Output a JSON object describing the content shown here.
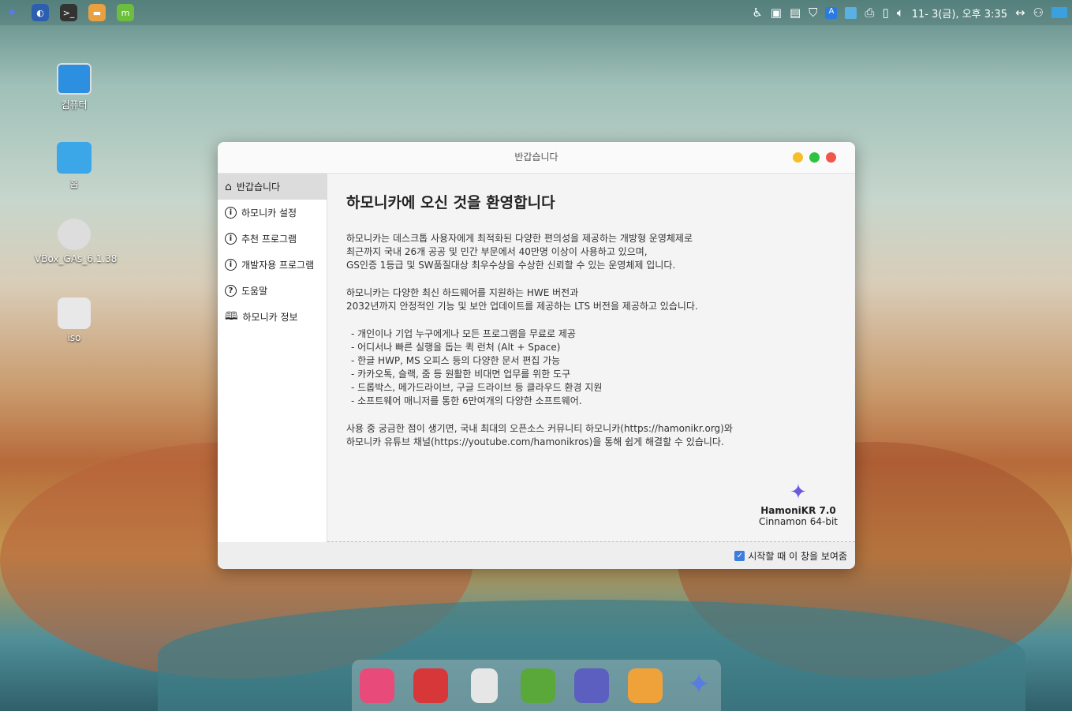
{
  "topbar": {
    "clock": "11- 3(금), 오후 3:35",
    "apps": [
      "hamonikr-menu",
      "whale-browser",
      "terminal",
      "files",
      "mintupdate"
    ],
    "terminal_glyph": ">_"
  },
  "desktop": {
    "icons": [
      {
        "label": "컴퓨터"
      },
      {
        "label": "홈"
      },
      {
        "label": "VBox_GAs_6.1.38"
      },
      {
        "label": "iso"
      }
    ]
  },
  "window": {
    "title": "반갑습니다",
    "sidebar": [
      {
        "label": "반갑습니다",
        "icon": "home-icon"
      },
      {
        "label": "하모니카 설정",
        "icon": "info-icon"
      },
      {
        "label": "추천 프로그램",
        "icon": "info-icon"
      },
      {
        "label": "개발자용 프로그램",
        "icon": "info-icon"
      },
      {
        "label": "도움말",
        "icon": "help-icon"
      },
      {
        "label": "하모니카 정보",
        "icon": "book-icon"
      }
    ],
    "heading": "하모니카에 오신 것을 환영합니다",
    "p1": [
      "하모니카는 데스크톱 사용자에게 최적화된 다양한 편의성을 제공하는 개방형 운영체제로",
      "최근까지 국내 26개 공공 및 민간 부문에서 40만명 이상이 사용하고 있으며,",
      "GS인증 1등급 및 SW품질대상 최우수상을 수상한 신뢰할 수 있는 운영체제 입니다."
    ],
    "p2": [
      "하모니카는 다양한 최신 하드웨어를 지원하는 HWE 버전과",
      "2032년까지 안정적인 기능 및 보안 업데이트를 제공하는 LTS 버전을 제공하고 있습니다."
    ],
    "list": [
      "- 개인이나 기업 누구에게나 모든 프로그램을 무료로 제공",
      "- 어디서나 빠른 실행을 돕는 퀵 런처 (Alt + Space)",
      "- 한글 HWP, MS 오피스 등의 다양한 문서 편집 가능",
      "- 카카오톡, 슬랙, 줌 등 원활한 비대면 업무를 위한 도구",
      "- 드롭박스, 메가드라이브, 구글 드라이브 등 클라우드 환경 지원",
      "- 소프트웨어 매니저를 통한 6만여개의 다양한 소프트웨어."
    ],
    "p3": [
      "사용 중 궁금한 점이 생기면, 국내 최대의 오픈소스 커뮤니티 하모니카(https://hamonikr.org)와",
      "하모니카 유튜브 채널(https://youtube.com/hamonikros)을 통해 쉽게 해결할 수 있습니다."
    ],
    "brand_name": "HamoniKR 7.0",
    "brand_edition": "Cinnamon 64-bit",
    "show_on_start": "시작할 때 이 창을 보여줌",
    "show_on_start_checked": true
  },
  "dock": [
    "app-launcher",
    "power",
    "trash",
    "software-manager",
    "video-player",
    "files",
    "hamonikr"
  ]
}
